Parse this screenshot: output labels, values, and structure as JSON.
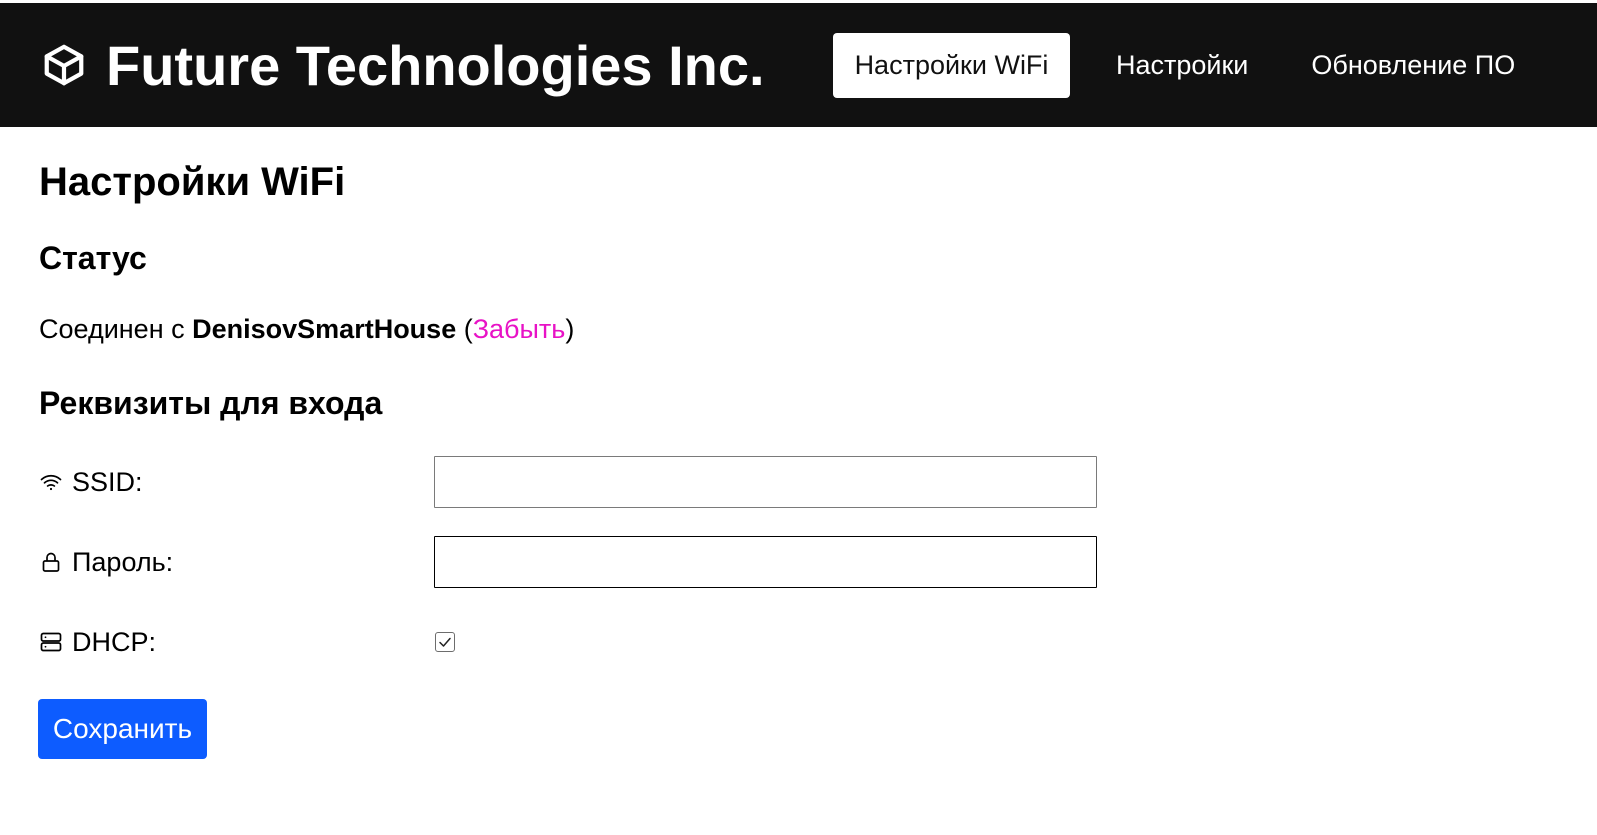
{
  "header": {
    "brand_title": "Future Technologies Inc.",
    "brand_icon": "box-icon",
    "nav": [
      {
        "label": "Настройки WiFi",
        "active": true
      },
      {
        "label": "Настройки",
        "active": false
      },
      {
        "label": "Обновление ПО",
        "active": false
      }
    ]
  },
  "page": {
    "title": "Настройки WiFi"
  },
  "status": {
    "heading": "Статус",
    "connected_prefix": "Соединен с ",
    "network_name": "DenisovSmartHouse",
    "paren_open": " (",
    "forget_label": "Забыть",
    "paren_close": ")",
    "link_color": "#e812c6"
  },
  "credentials": {
    "heading": "Реквизиты для входа",
    "ssid": {
      "label": "SSID:",
      "icon": "wifi-icon",
      "value": "",
      "placeholder": ""
    },
    "password": {
      "label": "Пароль:",
      "icon": "lock-icon",
      "value": "",
      "placeholder": ""
    },
    "dhcp": {
      "label": "DHCP:",
      "icon": "server-icon",
      "checked": true
    }
  },
  "actions": {
    "save_label": "Сохранить",
    "save_color": "#0d5cff"
  }
}
